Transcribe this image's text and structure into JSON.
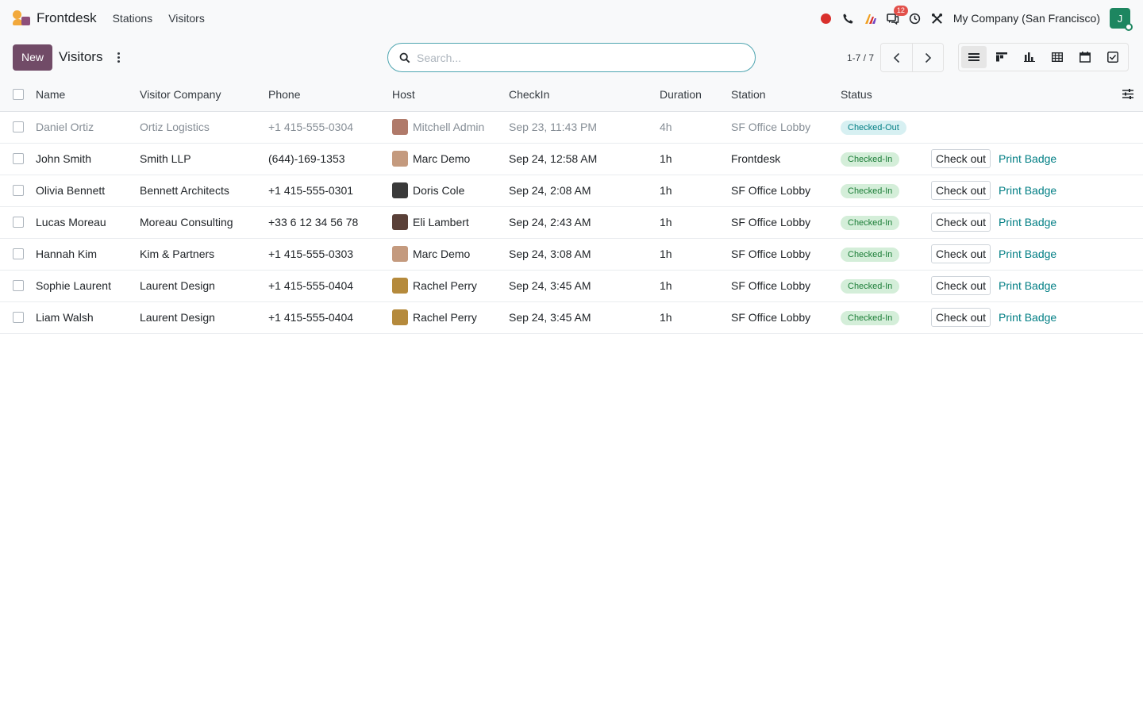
{
  "navbar": {
    "app_name": "Frontdesk",
    "menu": [
      {
        "label": "Stations"
      },
      {
        "label": "Visitors"
      }
    ],
    "messages_count": "12",
    "company": "My Company (San Francisco)",
    "user_initial": "J"
  },
  "control": {
    "new_label": "New",
    "title": "Visitors",
    "search_placeholder": "Search...",
    "pager": "1-7 / 7"
  },
  "table": {
    "columns": [
      "Name",
      "Visitor Company",
      "Phone",
      "Host",
      "CheckIn",
      "Duration",
      "Station",
      "Status"
    ],
    "check_out_label": "Check out",
    "print_badge_label": "Print Badge",
    "rows": [
      {
        "name": "Daniel Ortiz",
        "company": "Ortiz Logistics",
        "phone": "+1 415-555-0304",
        "host": "Mitchell Admin",
        "host_color": "#b07a6a",
        "checkin": "Sep 23, 11:43 PM",
        "duration": "4h",
        "station": "SF Office Lobby",
        "status": "Checked-Out",
        "muted": true,
        "actions": false
      },
      {
        "name": "John Smith",
        "company": "Smith LLP",
        "phone": "(644)-169-1353",
        "host": "Marc Demo",
        "host_color": "#c49a7e",
        "checkin": "Sep 24, 12:58 AM",
        "duration": "1h",
        "station": "Frontdesk",
        "status": "Checked-In",
        "muted": false,
        "actions": true
      },
      {
        "name": "Olivia Bennett",
        "company": "Bennett Architects",
        "phone": "+1 415-555-0301",
        "host": "Doris Cole",
        "host_color": "#3a3a3a",
        "checkin": "Sep 24, 2:08 AM",
        "duration": "1h",
        "station": "SF Office Lobby",
        "status": "Checked-In",
        "muted": false,
        "actions": true
      },
      {
        "name": "Lucas Moreau",
        "company": "Moreau Consulting",
        "phone": "+33 6 12 34 56 78",
        "host": "Eli Lambert",
        "host_color": "#5a4038",
        "checkin": "Sep 24, 2:43 AM",
        "duration": "1h",
        "station": "SF Office Lobby",
        "status": "Checked-In",
        "muted": false,
        "actions": true
      },
      {
        "name": "Hannah Kim",
        "company": "Kim & Partners",
        "phone": "+1 415-555-0303",
        "host": "Marc Demo",
        "host_color": "#c49a7e",
        "checkin": "Sep 24, 3:08 AM",
        "duration": "1h",
        "station": "SF Office Lobby",
        "status": "Checked-In",
        "muted": false,
        "actions": true
      },
      {
        "name": "Sophie Laurent",
        "company": "Laurent Design",
        "phone": "+1 415-555-0404",
        "host": "Rachel Perry",
        "host_color": "#b58a3c",
        "checkin": "Sep 24, 3:45 AM",
        "duration": "1h",
        "station": "SF Office Lobby",
        "status": "Checked-In",
        "muted": false,
        "actions": true
      },
      {
        "name": "Liam Walsh",
        "company": "Laurent Design",
        "phone": "+1 415-555-0404",
        "host": "Rachel Perry",
        "host_color": "#b58a3c",
        "checkin": "Sep 24, 3:45 AM",
        "duration": "1h",
        "station": "SF Office Lobby",
        "status": "Checked-In",
        "muted": false,
        "actions": true
      }
    ]
  }
}
